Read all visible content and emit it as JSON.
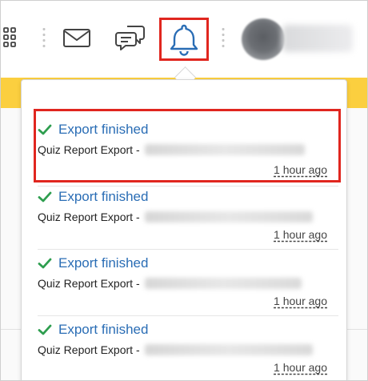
{
  "navbar": {
    "icons": [
      "apps-grid-icon",
      "mail-icon",
      "chat-icon",
      "bell-icon"
    ],
    "user": {
      "avatar": "avatar"
    }
  },
  "notifications": {
    "items": [
      {
        "status_icon": "check-icon",
        "title": "Export finished",
        "subtitle": "Quiz Report Export -",
        "time": "1 hour ago"
      },
      {
        "status_icon": "check-icon",
        "title": "Export finished",
        "subtitle": "Quiz Report Export -",
        "time": "1 hour ago"
      },
      {
        "status_icon": "check-icon",
        "title": "Export finished",
        "subtitle": "Quiz Report Export -",
        "time": "1 hour ago"
      },
      {
        "status_icon": "check-icon",
        "title": "Export finished",
        "subtitle": "Quiz Report Export -",
        "time": "1 hour ago"
      }
    ]
  },
  "colors": {
    "accent_link": "#2a6db5",
    "success_check": "#2e9e4f",
    "highlight_red": "#e0261f",
    "banner_yellow": "#fbcf3f"
  }
}
